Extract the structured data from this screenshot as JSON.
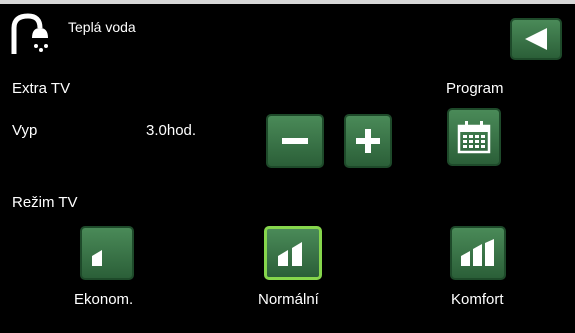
{
  "header": {
    "title": "Teplá voda",
    "back_icon": "back-arrow-icon",
    "app_icon": "shower-icon"
  },
  "extra_tv": {
    "label": "Extra TV",
    "status": "Vyp",
    "duration": "3.0hod."
  },
  "program": {
    "label": "Program",
    "icon": "calendar-icon"
  },
  "controls": {
    "minus_icon": "minus-icon",
    "plus_icon": "plus-icon"
  },
  "mode": {
    "label": "Režim TV",
    "selected": "Normální",
    "options": [
      {
        "label": "Ekonom.",
        "icon": "level-1-icon"
      },
      {
        "label": "Normální",
        "icon": "level-2-icon"
      },
      {
        "label": "Komfort",
        "icon": "level-3-icon"
      }
    ]
  },
  "colors": {
    "button": "#3a7a49",
    "selected_border": "#86d64c",
    "background": "#000000"
  }
}
